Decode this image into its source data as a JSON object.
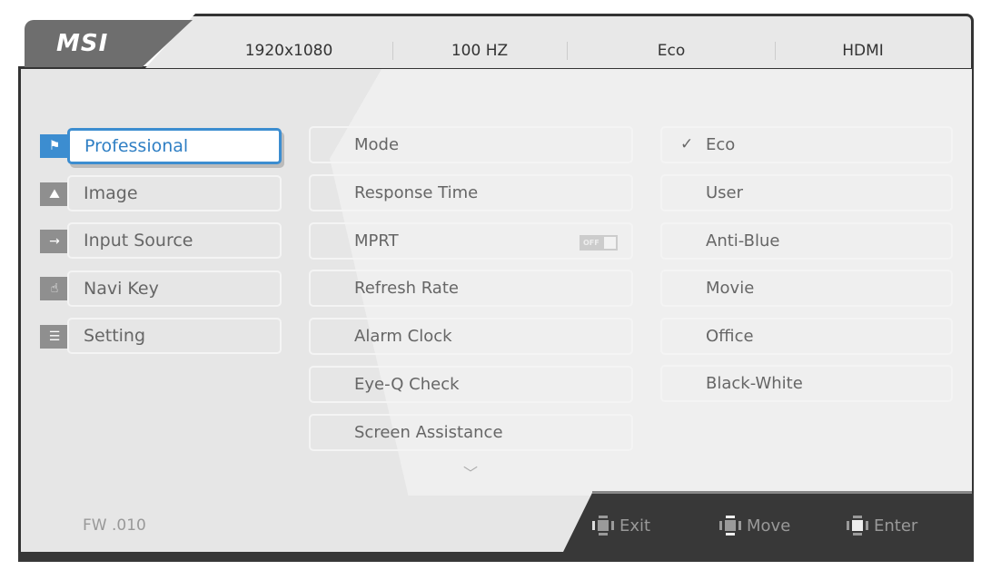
{
  "brand": "MSI",
  "header": {
    "resolution": "1920x1080",
    "refresh": "100 HZ",
    "mode": "Eco",
    "input": "HDMI"
  },
  "sidebar": {
    "items": [
      {
        "label": "Professional",
        "icon": "flag-icon",
        "active": true
      },
      {
        "label": "Image",
        "icon": "image-icon"
      },
      {
        "label": "Input Source",
        "icon": "arrow-right-icon"
      },
      {
        "label": "Navi Key",
        "icon": "hand-icon"
      },
      {
        "label": "Setting",
        "icon": "sliders-icon"
      }
    ]
  },
  "options": {
    "items": [
      {
        "label": "Mode"
      },
      {
        "label": "Response Time"
      },
      {
        "label": "MPRT",
        "toggle": "OFF"
      },
      {
        "label": "Refresh Rate"
      },
      {
        "label": "Alarm Clock"
      },
      {
        "label": "Eye-Q Check"
      },
      {
        "label": "Screen Assistance"
      }
    ]
  },
  "values": {
    "items": [
      {
        "label": "Eco",
        "selected": true,
        "check": "✓"
      },
      {
        "label": "User"
      },
      {
        "label": "Anti-Blue"
      },
      {
        "label": "Movie"
      },
      {
        "label": "Office"
      },
      {
        "label": "Black-White"
      }
    ]
  },
  "footer": {
    "firmware": "FW .010",
    "exit": "Exit",
    "move": "Move",
    "enter": "Enter"
  },
  "colors": {
    "accent": "#3c8dd0",
    "bar": "#383838"
  }
}
